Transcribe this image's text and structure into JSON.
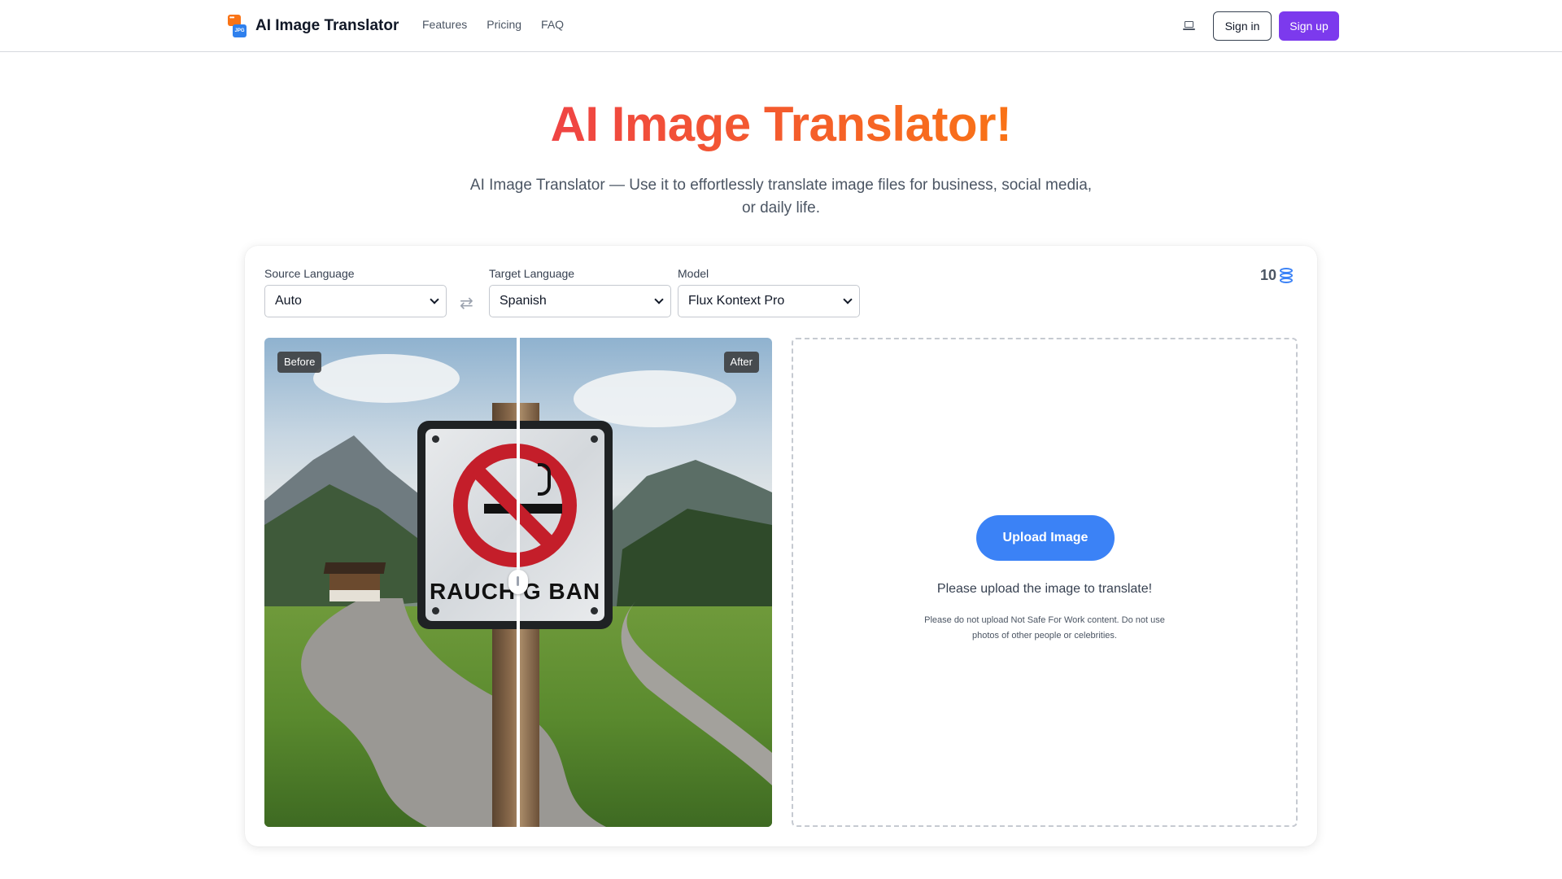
{
  "header": {
    "brand": "AI Image Translator",
    "logo_badge": "JPG",
    "nav": [
      "Features",
      "Pricing",
      "FAQ"
    ],
    "theme_icon": "laptop-icon",
    "sign_in": "Sign in",
    "sign_up": "Sign up"
  },
  "hero": {
    "title": "AI Image Translator!",
    "subtitle": "AI Image Translator — Use it to effortlessly translate image files for business, social media, or daily life."
  },
  "controls": {
    "source_label": "Source Language",
    "source_value": "Auto",
    "target_label": "Target Language",
    "target_value": "Spanish",
    "model_label": "Model",
    "model_value": "Flux Kontext Pro",
    "swap_icon": "⇄",
    "credits": "10",
    "credits_icon": "database-icon"
  },
  "preview": {
    "before_tag": "Before",
    "after_tag": "After",
    "sign_text": "RAUCH G BAN"
  },
  "upload": {
    "button": "Upload Image",
    "message": "Please upload the image to translate!",
    "note": "Please do not upload Not Safe For Work content. Do not use photos of other people or celebrities."
  },
  "colors": {
    "title_gradient_start": "#ef4444",
    "title_gradient_end": "#f97316",
    "signup_bg": "#7c3aed",
    "upload_bg": "#3b82f6"
  }
}
